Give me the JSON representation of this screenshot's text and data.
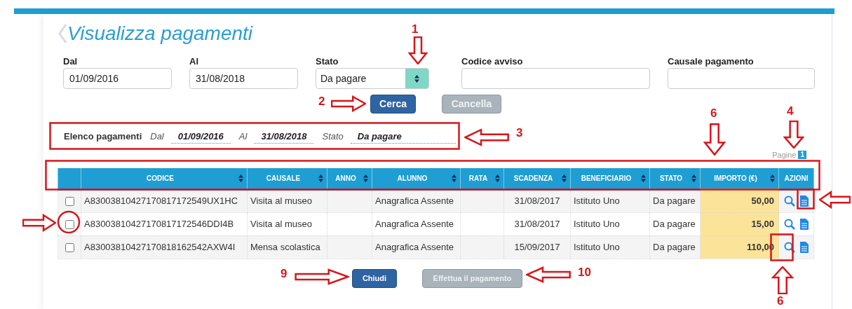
{
  "title": "Visualizza pagamenti",
  "filters": [
    {
      "kind": "input",
      "label": "Dal",
      "value": "01/09/2016"
    },
    {
      "kind": "input",
      "label": "Al",
      "value": "31/08/2018"
    },
    {
      "kind": "select",
      "label": "Stato",
      "value": "Da pagare"
    },
    {
      "kind": "input",
      "label": "Codice avviso"
    },
    {
      "kind": "input",
      "label": "Causale pagamento"
    }
  ],
  "form_buttons": [
    {
      "label": "Cerca",
      "disabled": false
    },
    {
      "label": "Cancella",
      "disabled": true
    }
  ],
  "summary": {
    "label": "Elenco pagamenti",
    "items": [
      {
        "label": "Dal",
        "value": "01/09/2016"
      },
      {
        "label": "Al",
        "value": "31/08/2018"
      },
      {
        "label": "Stato",
        "value": "Da pagare"
      }
    ]
  },
  "pagination": {
    "label": "Pagine",
    "pages": [
      {
        "label": "1",
        "selected": true
      }
    ]
  },
  "table": {
    "columns": [
      {
        "sortable": false,
        "highlighted": false
      },
      {
        "label": "CODICE",
        "sortable": true,
        "highlighted": false
      },
      {
        "label": "CAUSALE",
        "sortable": true,
        "highlighted": false
      },
      {
        "label": "ANNO",
        "sortable": true,
        "highlighted": false
      },
      {
        "label": "ALUNNO",
        "sortable": true,
        "highlighted": false
      },
      {
        "label": "RATA",
        "sortable": true,
        "highlighted": false
      },
      {
        "label": "SCADENZA",
        "sortable": true,
        "highlighted": false
      },
      {
        "label": "BENEFICIARIO",
        "sortable": true,
        "highlighted": false
      },
      {
        "label": "STATO",
        "sortable": true,
        "highlighted": false
      },
      {
        "label": "IMPORTO (€)",
        "sortable": true,
        "highlighted": true
      },
      {
        "label": "AZIONI",
        "sortable": false,
        "highlighted": false
      }
    ],
    "rows": [
      {
        "checked": false,
        "codice": "A83003810427170817172549UX1HC",
        "causale": "Visita al museo",
        "alunno": "Anagrafica Assente",
        "scadenza": "31/08/2017",
        "beneficiario": "Istituto Uno",
        "stato": "Da pagare",
        "importo": "50,00"
      },
      {
        "checked": false,
        "codice": "A83003810427170817172546DDI4B",
        "causale": "Visita al museo",
        "alunno": "Anagrafica Assente",
        "scadenza": "31/08/2017",
        "beneficiario": "Istituto Uno",
        "stato": "Da pagare",
        "importo": "15,00"
      },
      {
        "checked": false,
        "codice": "A83003810427170818162542AXW4I",
        "causale": "Mensa scolastica",
        "alunno": "Anagrafica Assente",
        "scadenza": "15/09/2017",
        "beneficiario": "Istituto Uno",
        "stato": "Da pagare",
        "importo": "110,00"
      }
    ]
  },
  "bottom_buttons": [
    {
      "label": "Chiudi",
      "disabled": false
    },
    {
      "label": "Effettua il pagamento",
      "disabled": true
    }
  ],
  "annotations": [
    "1",
    "2",
    "3",
    "4",
    "6",
    "6",
    "9",
    "10"
  ]
}
